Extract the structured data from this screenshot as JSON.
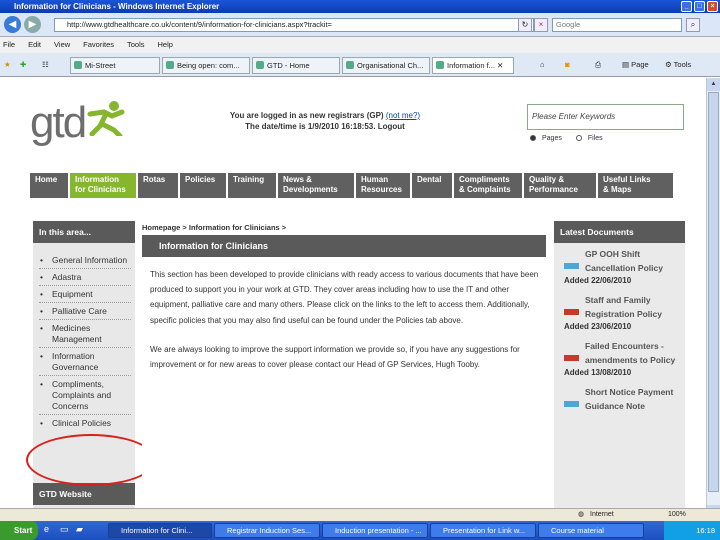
{
  "window": {
    "title": "Information for Clinicians - Windows Internet Explorer"
  },
  "address": {
    "url": "http://www.gtdhealthcare.co.uk/content/9/information-for-clinicians.aspx?trackit=",
    "search_placeholder": "Google"
  },
  "menu": [
    "File",
    "Edit",
    "View",
    "Favorites",
    "Tools",
    "Help"
  ],
  "browser_tabs": [
    "Mi-Street",
    "Being open: com...",
    "GTD - Home",
    "Organisational Ch...",
    "Information f..."
  ],
  "toolbar": {
    "page_label": "Page",
    "tools_label": "Tools"
  },
  "site": {
    "logo_text": "gtd",
    "login_prefix": "You are logged in as new registrars (GP)",
    "not_me": "(not me?)",
    "datetime": "The date/time is 1/9/2010 16:18:53.",
    "logout": "Logout",
    "search_placeholder": "Please Enter Keywords",
    "radio_pages": "Pages",
    "radio_files": "Files"
  },
  "nav": [
    {
      "l1": "Home",
      "l2": ""
    },
    {
      "l1": "Information",
      "l2": "for Clinicians"
    },
    {
      "l1": "Rotas",
      "l2": ""
    },
    {
      "l1": "Policies",
      "l2": ""
    },
    {
      "l1": "Training",
      "l2": ""
    },
    {
      "l1": "News &",
      "l2": "Developments"
    },
    {
      "l1": "Human",
      "l2": "Resources"
    },
    {
      "l1": "Dental",
      "l2": ""
    },
    {
      "l1": "Compliments",
      "l2": "& Complaints"
    },
    {
      "l1": "Quality &",
      "l2": "Performance"
    },
    {
      "l1": "Useful Links",
      "l2": "& Maps"
    }
  ],
  "left_panel": {
    "title": "In this area...",
    "items": [
      "General Information",
      "Adastra",
      "Equipment",
      "Palliative Care",
      "Medicines Management",
      "Information Governance",
      "Compliments, Complaints and Concerns",
      "Clinical Policies"
    ],
    "footer": "GTD Website"
  },
  "breadcrumb": "Homepage > Information for Clinicians >",
  "main": {
    "title": "Information for Clinicians",
    "para1": "This section has been developed to provide clinicians with ready access to various documents that have been produced to support you in your work at GTD. They cover areas including how to use the IT and other equipment, palliative care and many others. Please click on the links to the left to access them. Additionally, specific policies that you may also find useful can be found under the Policies tab above.",
    "para2": "We are always looking to improve the support information we provide so, if you have any suggestions for improvement or for new areas to cover please contact our Head of GP Services, Hugh Tooby."
  },
  "right_panel": {
    "title": "Latest Documents",
    "docs": [
      {
        "title": "GP OOH Shift Cancellation Policy",
        "added": "Added 22/06/2010",
        "icon": "doc-blue"
      },
      {
        "title": "Staff and Family Registration Policy",
        "added": "Added 23/06/2010",
        "icon": "doc-red"
      },
      {
        "title": "Failed Encounters - amendments to Policy",
        "added": "Added 13/08/2010",
        "icon": "doc-red"
      },
      {
        "title": "Short Notice Payment Guidance Note",
        "added": "",
        "icon": "doc-blue"
      }
    ]
  },
  "status": {
    "zone": "Internet",
    "zoom": "100%"
  },
  "taskbar": {
    "start": "Start",
    "tasks": [
      "Information for Clini...",
      "Registrar Induction Ses...",
      "Induction presentation - ...",
      "Presentation for Link w...",
      "Course material"
    ],
    "clock": "16:18"
  }
}
